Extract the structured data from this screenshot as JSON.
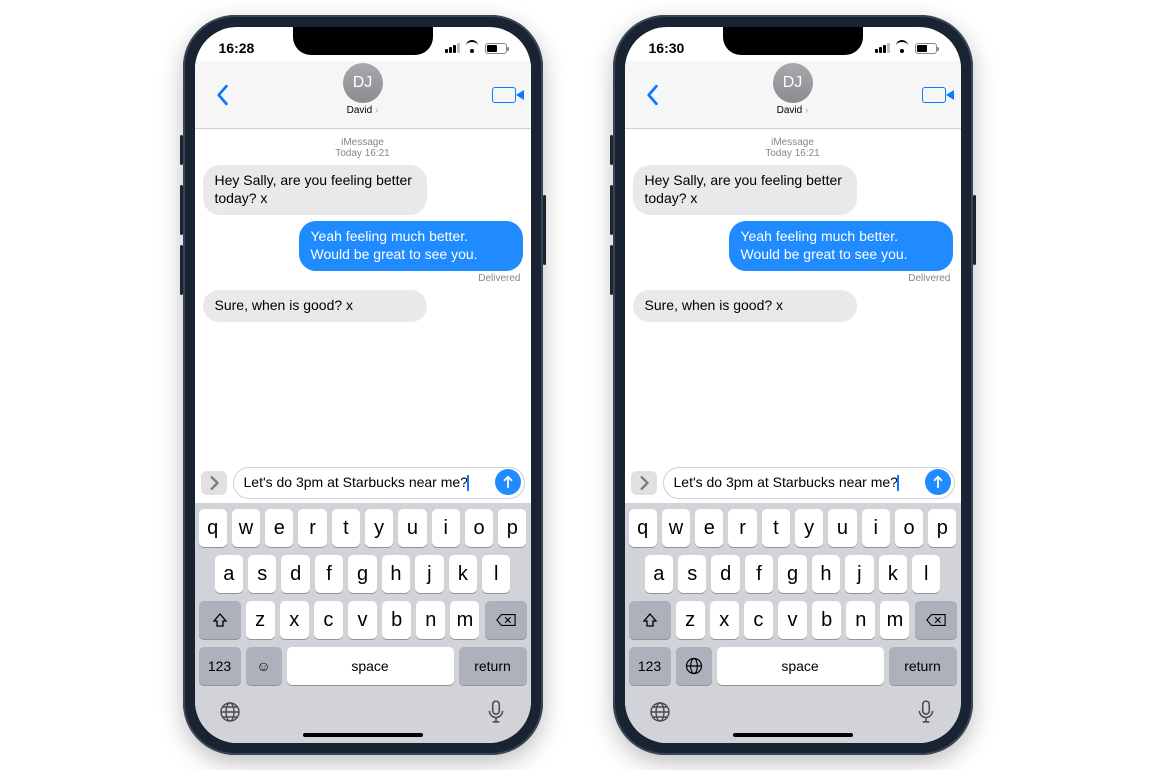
{
  "phones": [
    {
      "time": "16:28",
      "avatar_initials": "DJ",
      "contact_name": "David",
      "service_label": "iMessage",
      "timestamp": "Today 16:21",
      "messages": {
        "m1": "Hey Sally, are you feeling better today? x",
        "m2": "Yeah feeling much better. Would be great to see you.",
        "m3": "Sure, when is good? x"
      },
      "delivered": "Delivered",
      "draft": "Let's do 3pm at Starbucks near me?",
      "has_emoji_key": true
    },
    {
      "time": "16:30",
      "avatar_initials": "DJ",
      "contact_name": "David",
      "service_label": "iMessage",
      "timestamp": "Today 16:21",
      "messages": {
        "m1": "Hey Sally, are you feeling better today? x",
        "m2": "Yeah feeling much better. Would be great to see you.",
        "m3": "Sure, when is good? x"
      },
      "delivered": "Delivered",
      "draft": "Let's do 3pm at Starbucks near me?",
      "has_emoji_key": false
    }
  ],
  "keyboard": {
    "row1": [
      "q",
      "w",
      "e",
      "r",
      "t",
      "y",
      "u",
      "i",
      "o",
      "p"
    ],
    "row2": [
      "a",
      "s",
      "d",
      "f",
      "g",
      "h",
      "j",
      "k",
      "l"
    ],
    "row3": [
      "z",
      "x",
      "c",
      "v",
      "b",
      "n",
      "m"
    ],
    "num_label": "123",
    "space_label": "space",
    "return_label": "return"
  }
}
